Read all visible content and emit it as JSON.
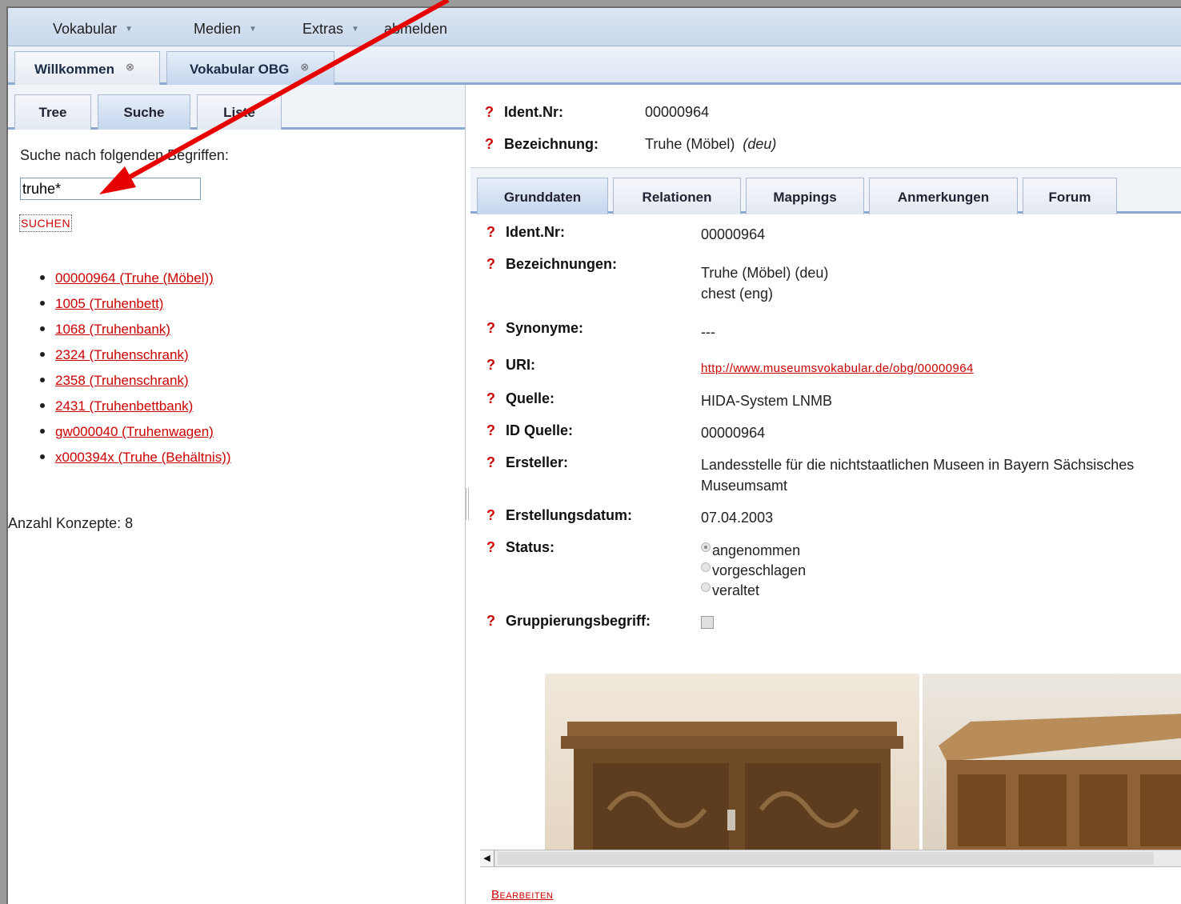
{
  "menu": {
    "items": [
      {
        "label": "Vokabular",
        "has_dropdown": true
      },
      {
        "label": "Medien",
        "has_dropdown": true
      },
      {
        "label": "Extras",
        "has_dropdown": true
      },
      {
        "label": "abmelden",
        "has_dropdown": false
      }
    ],
    "caret": "▼"
  },
  "top_tabs": [
    {
      "label": "Willkommen",
      "close": "⊗",
      "active": false
    },
    {
      "label": "Vokabular OBG",
      "close": "⊗",
      "active": true
    }
  ],
  "left": {
    "tabs": [
      {
        "label": "Tree",
        "active": false
      },
      {
        "label": "Suche",
        "active": true
      },
      {
        "label": "Liste",
        "active": false
      }
    ],
    "search_label": "Suche nach folgenden Begriffen:",
    "search_value": "truhe*",
    "search_button": "SUCHEN",
    "results": [
      "00000964 (Truhe (Möbel))",
      "1005 (Truhenbett)",
      "1068 (Truhenbank)",
      "2324 (Truhenschrank)",
      "2358 (Truhenschrank)",
      "2431 (Truhenbettbank)",
      "gw000040 (Truhenwagen)",
      "x000394x (Truhe (Behältnis))"
    ],
    "count_text": "Anzahl Konzepte: 8"
  },
  "right": {
    "help_mark": "?",
    "header": {
      "ident_label": "Ident.Nr:",
      "ident_value": "00000964",
      "bez_label": "Bezeichnung:",
      "bez_value": "Truhe (Möbel)",
      "bez_lang": "(deu)"
    },
    "tabs": [
      {
        "label": "Grunddaten",
        "active": true
      },
      {
        "label": "Relationen",
        "active": false
      },
      {
        "label": "Mappings",
        "active": false
      },
      {
        "label": "Anmerkungen",
        "active": false
      },
      {
        "label": "Forum",
        "active": false
      }
    ],
    "fields": {
      "ident": {
        "label": "Ident.Nr:",
        "value": "00000964"
      },
      "bezeichnungen": {
        "label": "Bezeichnungen:",
        "value1": "Truhe (Möbel)  (deu)",
        "value2": "chest  (eng)"
      },
      "synonyme": {
        "label": "Synonyme:",
        "value": "---"
      },
      "uri": {
        "label": "URI:",
        "value": "http://www.museumsvokabular.de/obg/00000964"
      },
      "quelle": {
        "label": "Quelle:",
        "value": "HIDA-System LNMB"
      },
      "id_quelle": {
        "label": "ID Quelle:",
        "value": "00000964"
      },
      "ersteller": {
        "label": "Ersteller:",
        "value1": "Landesstelle für die nichtstaatlichen Museen in Bayern Sächsisches",
        "value2": "Museumsamt"
      },
      "erstellungsdatum": {
        "label": "Erstellungsdatum:",
        "value": "07.04.2003"
      },
      "status": {
        "label": "Status:",
        "options": [
          {
            "label": "angenommen",
            "selected": true
          },
          {
            "label": "vorgeschlagen",
            "selected": false
          },
          {
            "label": "veraltet",
            "selected": false
          }
        ]
      },
      "gruppierung": {
        "label": "Gruppierungsbegriff:",
        "checked": false
      }
    },
    "edit_button": "Bearbeiten"
  },
  "colors": {
    "link": "#cc0000",
    "tab_border": "#8ba9d2",
    "arrow": "#e60000"
  }
}
